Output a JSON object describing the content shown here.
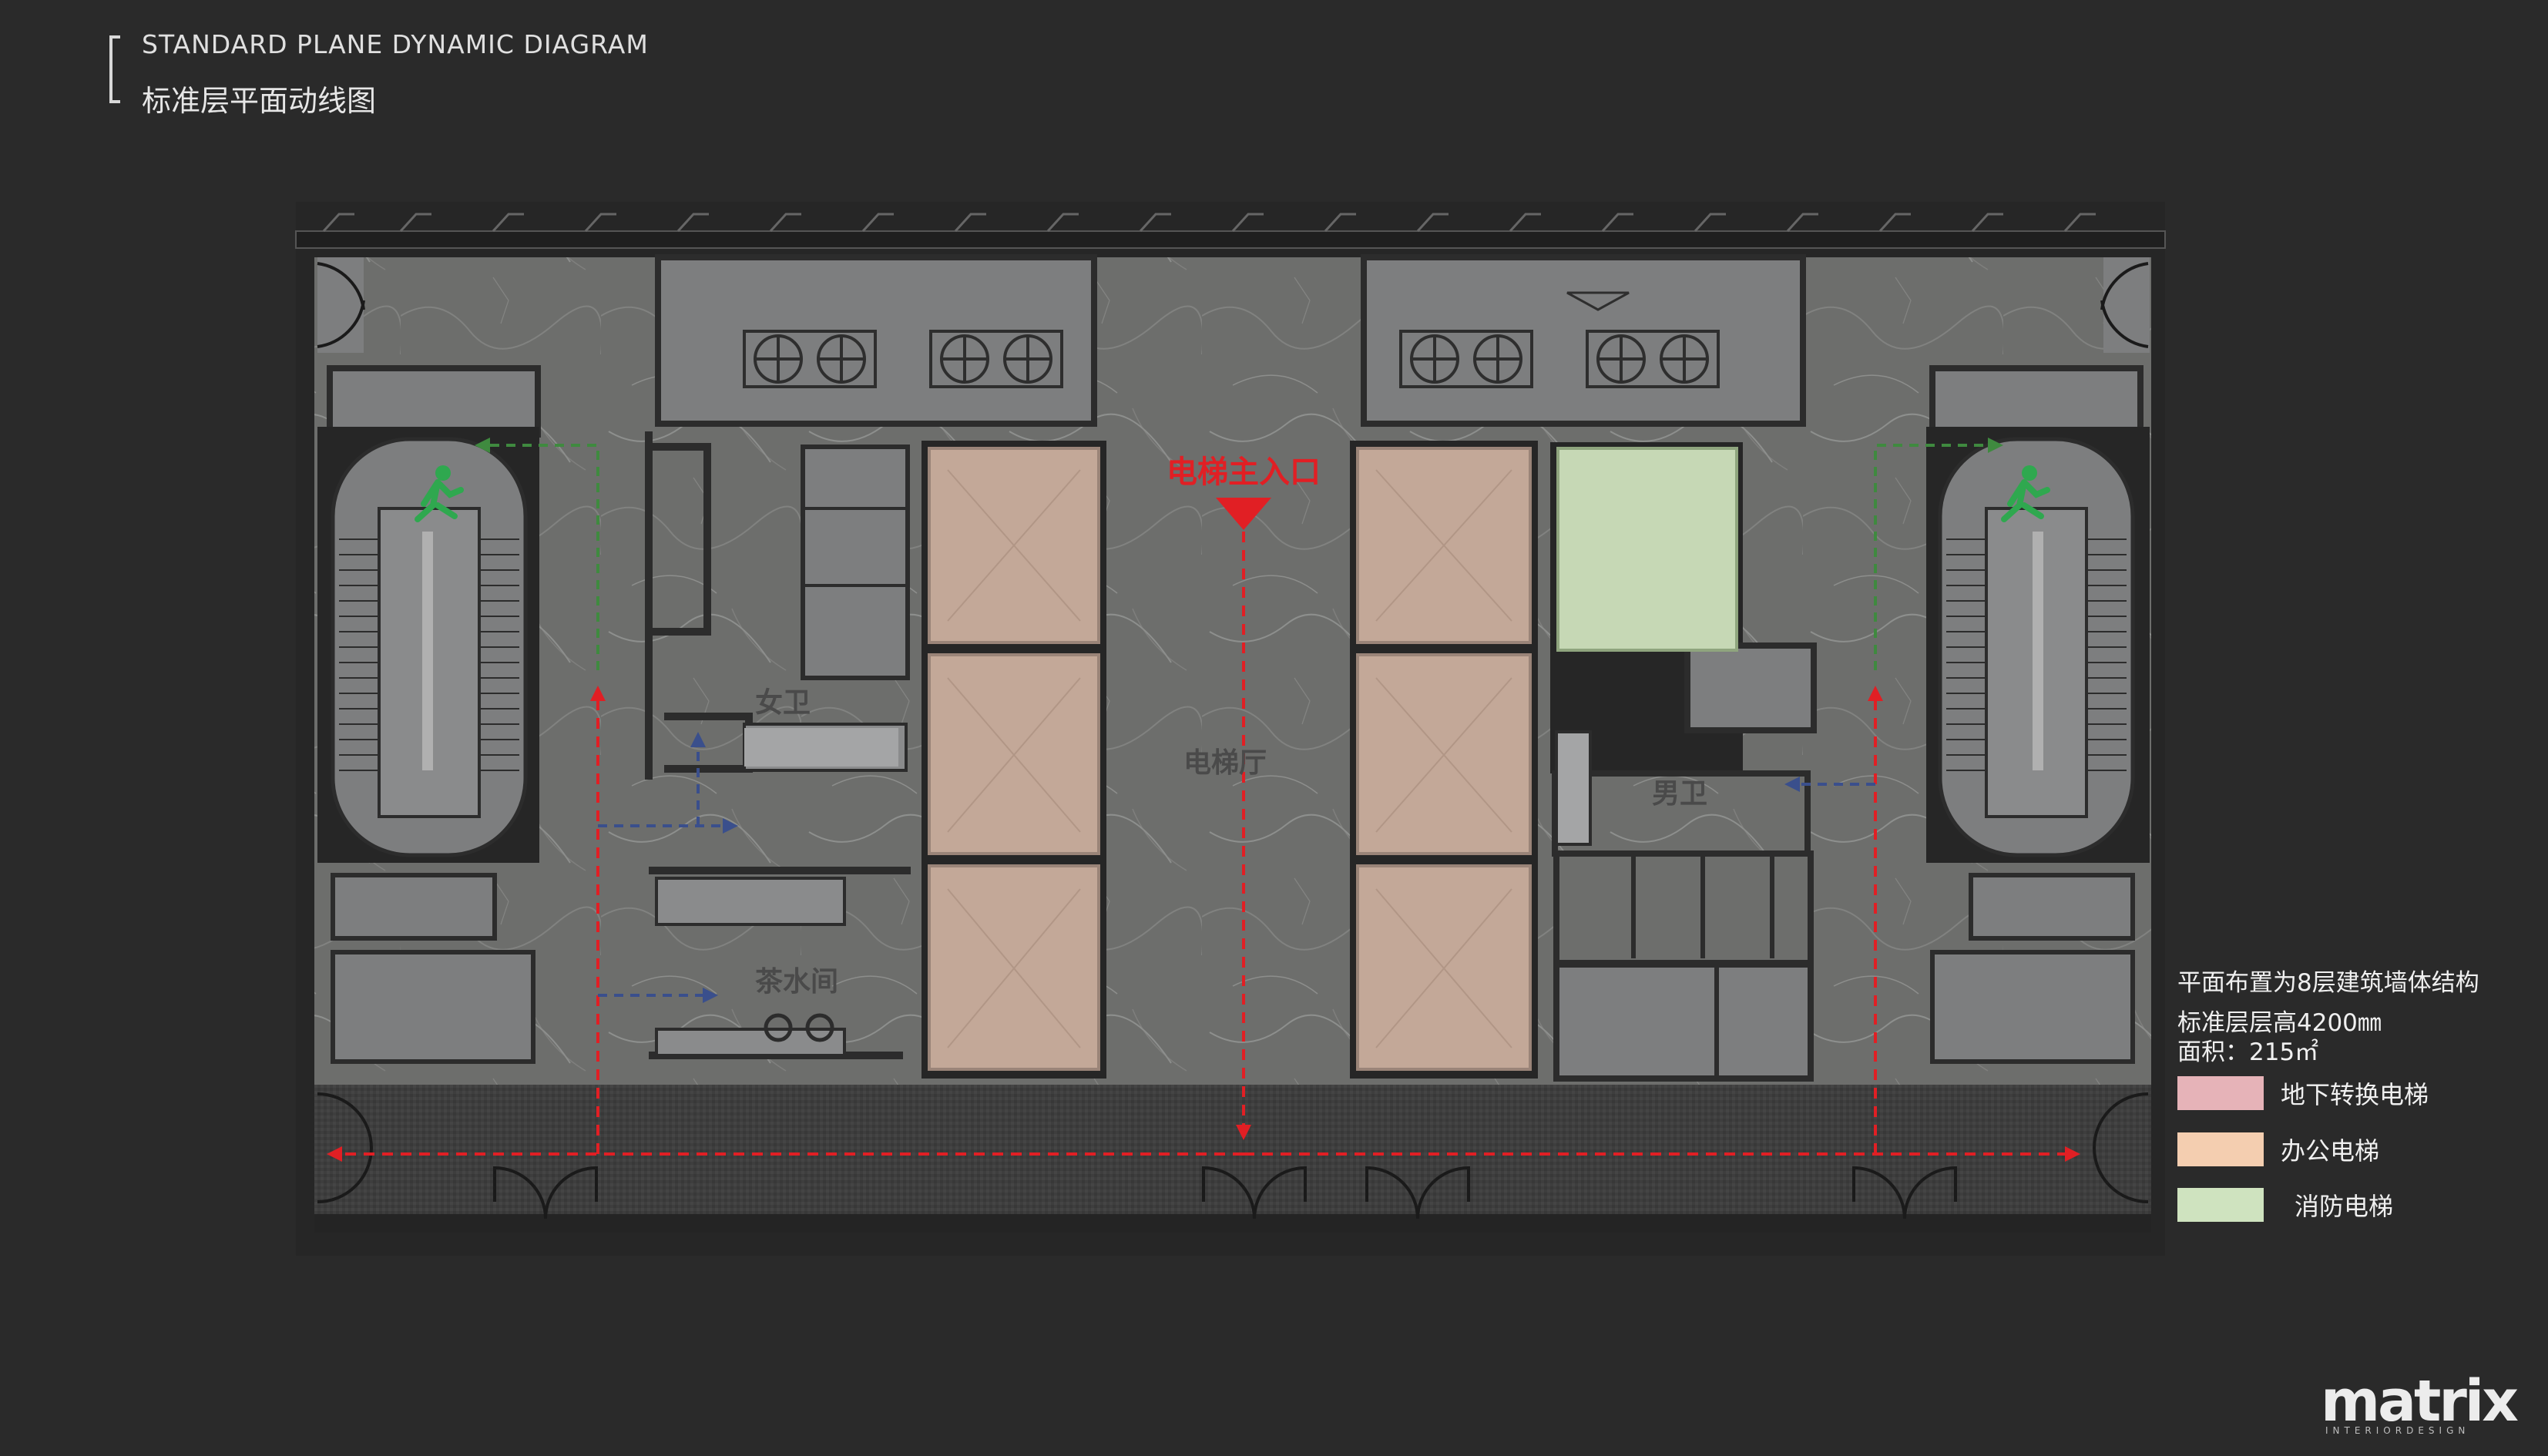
{
  "header": {
    "title_en": "STANDARD PLANE DYNAMIC DIAGRAM",
    "title_cn": "标准层平面动线图"
  },
  "plan": {
    "entrance_label": "电梯主入口",
    "lobby_label": "电梯厅",
    "womens_restroom_label": "女卫",
    "pantry_label": "茶水间",
    "mens_restroom_label": "男卫"
  },
  "notes": {
    "line1": "平面布置为8层建筑墙体结构",
    "line2": "标准层层高4200㎜",
    "line3": "面积：215㎡"
  },
  "legend": [
    {
      "label": "地下转换电梯",
      "color": "#e6b3b8"
    },
    {
      "label": "办公电梯",
      "color": "#f4ceb0"
    },
    {
      "label": "消防电梯",
      "color": "#cfe3bf"
    }
  ],
  "colors": {
    "background": "#2a2a2a",
    "marble": "#6d6e6c",
    "room": "#7d7e7f",
    "wall": "#2c2c2c",
    "elevator_office": "#c3a898",
    "elevator_fire": "#c6d8b5",
    "path_main": "#e11f24",
    "path_restroom": "#3a4f8c",
    "path_exit": "#3f8a3f"
  },
  "brand": {
    "name": "matrix",
    "tagline": "INTERIORDESIGN"
  }
}
